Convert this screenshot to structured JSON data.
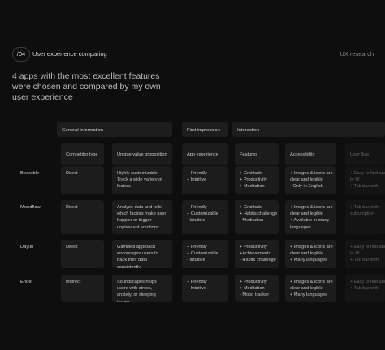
{
  "header": {
    "badge": "/04",
    "title": "User experience comparing",
    "tag": "UX research"
  },
  "intro": "4 apps with the most excellent features were chosen and compared by my own user experience",
  "groups": {
    "general": "General information",
    "first_impression": "First impression",
    "interaction": "Interaction"
  },
  "columns": {
    "competitor_type": "Competitor type",
    "unique_value": "Unique value proposition",
    "app_experience": "App experience",
    "features": "Features",
    "accessibility": "Accessibility",
    "user_flow": "User flow"
  },
  "rows": [
    {
      "name": "Bearable",
      "type": "Direct",
      "value": "Highly customizable Track a wide variety of factors",
      "experience": [
        "+ Friendly",
        "+ Intuitive"
      ],
      "features": [
        "+ Gratitude",
        "+ Productivity",
        "+ Meditation"
      ],
      "accessibility": [
        "+ Images & icons are",
        "clear and legible",
        "- Only in English"
      ],
      "flow": [
        "+ Easy to find and",
        "to fill",
        "+ Tab bar with"
      ]
    },
    {
      "name": "Moodflow",
      "type": "Direct",
      "value": "Analyze data and tells which factors make user happier or trigger unpleasant emotions",
      "experience": [
        "+ Friendly",
        "+ Customizable",
        "- Intuitive"
      ],
      "features": [
        "+ Gratitude",
        "+ Habits challenge",
        "- Meditation"
      ],
      "accessibility": [
        "+ Images & icons are",
        "clear and legible",
        "+ Available in many",
        "languages"
      ],
      "flow": [
        "+ Tab bar with",
        "subscription"
      ]
    },
    {
      "name": "Daylio",
      "type": "Direct",
      "value": "Gamified approach encourages users to track their data consistently",
      "experience": [
        "+ Friendly",
        "+ Customizable",
        "- Intuitive"
      ],
      "features": [
        "+ Productivity",
        "+Achievements",
        "- Habits challenge"
      ],
      "accessibility": [
        "+ Images & icons are",
        "clear and legible",
        "+ Many languages"
      ],
      "flow": [
        "+ Easy to find and",
        "to fill",
        "+ Tab bar with"
      ]
    },
    {
      "name": "Endel",
      "type": "Indirect",
      "value": "Soundscapes helps users with stress, anxiety, or sleeping issues",
      "experience": [
        "+ Friendly",
        "+ Intuitive"
      ],
      "features": [
        "+ Productivity",
        "+ Meditation",
        "- Mood tracker"
      ],
      "accessibility": [
        "+ Images & icons are",
        "clear and legible",
        "+ Many languages"
      ],
      "flow": [
        "+ Easy to find and",
        "+ Tab bar with"
      ]
    }
  ]
}
